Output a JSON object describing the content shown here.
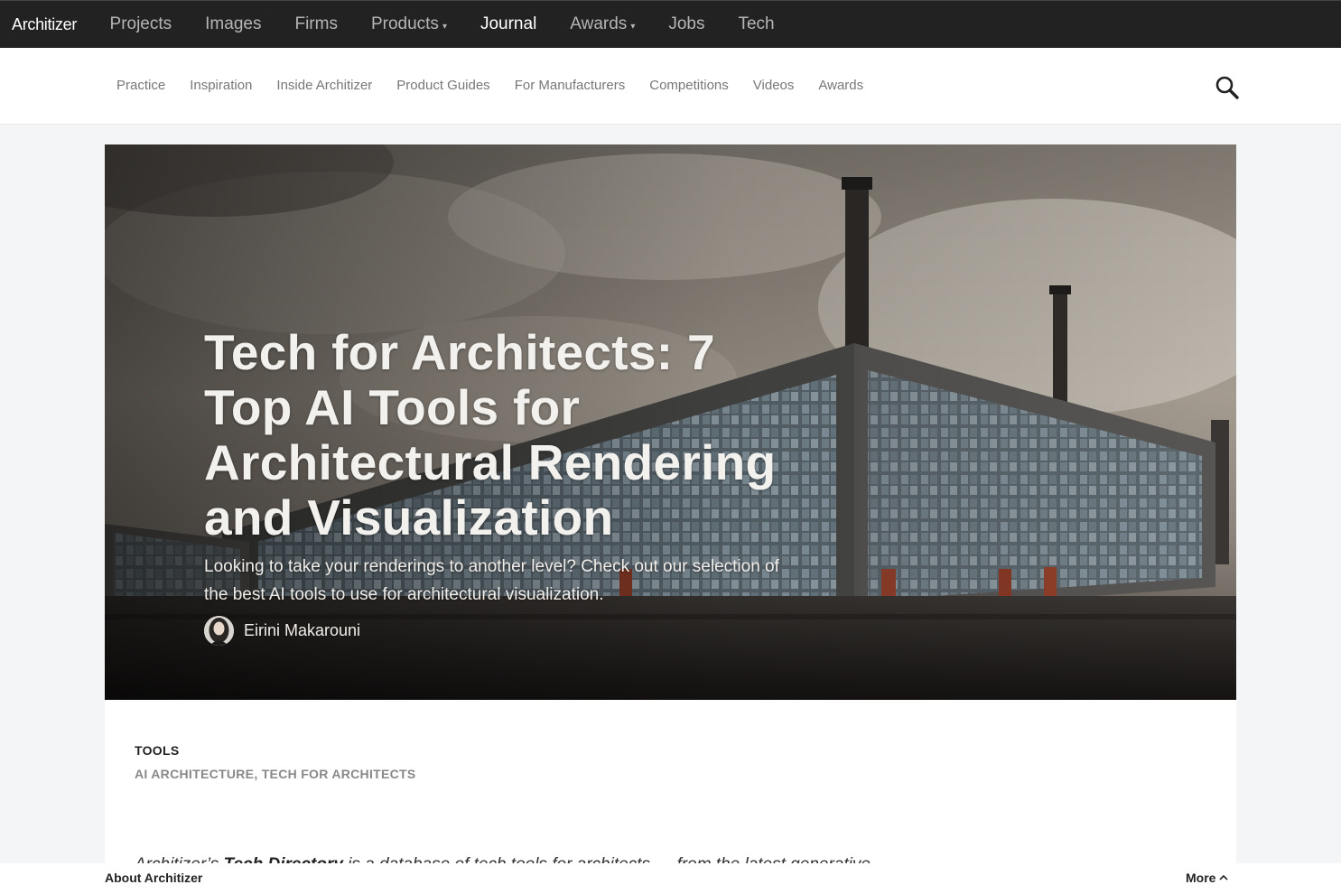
{
  "topnav": {
    "logo": "Architizer",
    "items": [
      {
        "label": "Projects",
        "dropdown": false,
        "active": false
      },
      {
        "label": "Images",
        "dropdown": false,
        "active": false
      },
      {
        "label": "Firms",
        "dropdown": false,
        "active": false
      },
      {
        "label": "Products",
        "dropdown": true,
        "active": false
      },
      {
        "label": "Journal",
        "dropdown": false,
        "active": true
      },
      {
        "label": "Awards",
        "dropdown": true,
        "active": false
      },
      {
        "label": "Jobs",
        "dropdown": false,
        "active": false
      },
      {
        "label": "Tech",
        "dropdown": false,
        "active": false
      }
    ],
    "caret": "▾"
  },
  "subnav": {
    "items": [
      "Practice",
      "Inspiration",
      "Inside Architizer",
      "Product Guides",
      "For Manufacturers",
      "Competitions",
      "Videos",
      "Awards"
    ],
    "search_icon": "search-icon"
  },
  "hero": {
    "title": "Tech for Architects: 7 Top AI Tools for Architectural Rendering and Visualization",
    "subtitle": "Looking to take your renderings to another level? Check out our selection of the best AI tools to use for architectural visualization.",
    "author": "Eirini Makarouni"
  },
  "article": {
    "category": "TOOLS",
    "tags": [
      "AI ARCHITECTURE",
      "TECH FOR ARCHITECTS"
    ],
    "tag_separator": ", ",
    "intro_prefix": "Architizer’s ",
    "intro_link": "Tech Directory",
    "intro_rest": " is a database of tech tools for architects — from the latest generative"
  },
  "footer": {
    "about": "About Architizer",
    "more": "More"
  },
  "colors": {
    "topnav_bg": "#222222",
    "page_bg": "#f4f5f6",
    "hero_text": "#f3f1ee"
  }
}
